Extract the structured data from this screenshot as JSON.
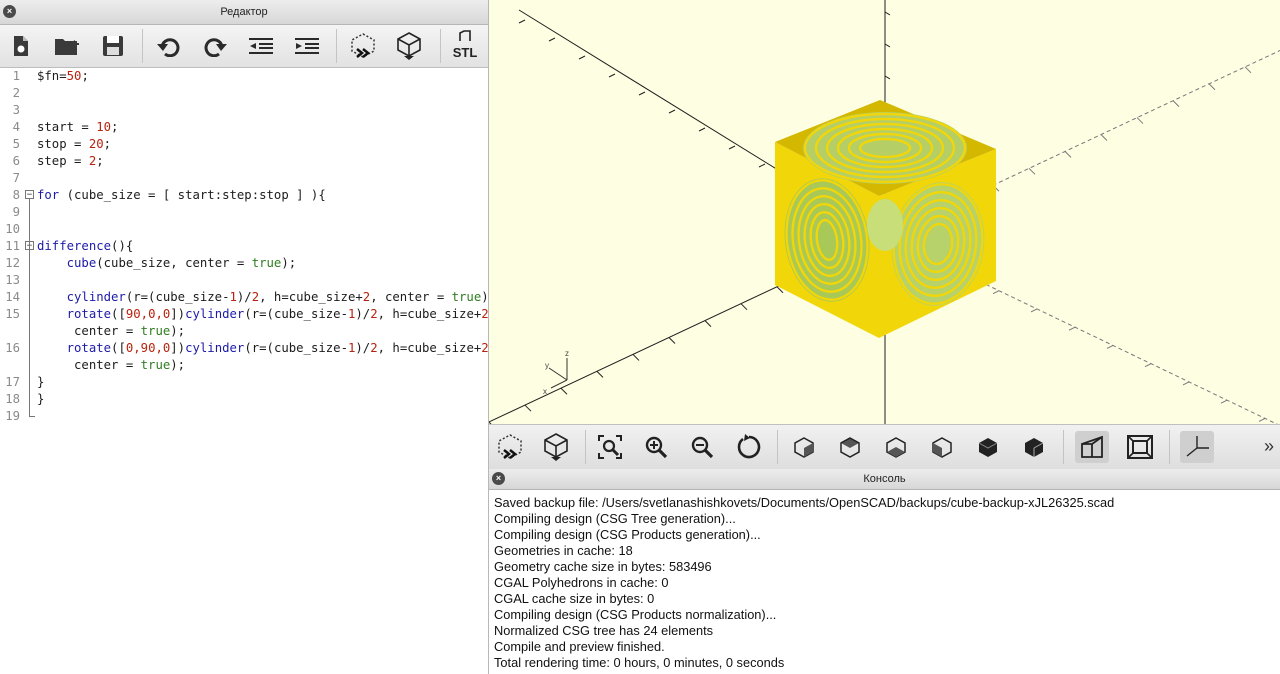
{
  "editor": {
    "title": "Редактор",
    "toolbar": {
      "stl_label": "STL",
      "buttons": [
        "new-file-icon",
        "open-file-icon",
        "save-icon",
        "undo-icon",
        "redo-icon",
        "unindent-icon",
        "indent-icon",
        "preview-icon",
        "render-icon",
        "export-stl-icon"
      ]
    },
    "lines": [
      {
        "n": "1",
        "tokens": [
          [
            "var",
            "$fn"
          ],
          [
            "op",
            "="
          ],
          [
            "num",
            "50"
          ],
          [
            "op",
            ";"
          ]
        ]
      },
      {
        "n": "2",
        "tokens": []
      },
      {
        "n": "3",
        "tokens": []
      },
      {
        "n": "4",
        "tokens": [
          [
            "var",
            "start "
          ],
          [
            "op",
            "= "
          ],
          [
            "num",
            "10"
          ],
          [
            "op",
            ";"
          ]
        ]
      },
      {
        "n": "5",
        "tokens": [
          [
            "var",
            "stop "
          ],
          [
            "op",
            "= "
          ],
          [
            "num",
            "20"
          ],
          [
            "op",
            ";"
          ]
        ]
      },
      {
        "n": "6",
        "tokens": [
          [
            "var",
            "step "
          ],
          [
            "op",
            "= "
          ],
          [
            "num",
            "2"
          ],
          [
            "op",
            ";"
          ]
        ]
      },
      {
        "n": "7",
        "tokens": []
      },
      {
        "n": "8",
        "fold": "start",
        "tokens": [
          [
            "kw",
            "for"
          ],
          [
            "op",
            " (cube_size = [ start:step:stop ] ){"
          ]
        ]
      },
      {
        "n": "9",
        "tokens": []
      },
      {
        "n": "10",
        "tokens": []
      },
      {
        "n": "11",
        "fold": "start",
        "tokens": [
          [
            "kw",
            "difference"
          ],
          [
            "op",
            "(){"
          ]
        ]
      },
      {
        "n": "12",
        "tokens": [
          [
            "fn",
            "    cube"
          ],
          [
            "op",
            "(cube_size, center = "
          ],
          [
            "bool",
            "true"
          ],
          [
            "op",
            ");"
          ]
        ]
      },
      {
        "n": "13",
        "tokens": []
      },
      {
        "n": "14",
        "tokens": [
          [
            "fn",
            "    cylinder"
          ],
          [
            "op",
            "(r=(cube_size-"
          ],
          [
            "num",
            "1"
          ],
          [
            "op",
            ")/"
          ],
          [
            "num",
            "2"
          ],
          [
            "op",
            ", h=cube_size+"
          ],
          [
            "num",
            "2"
          ],
          [
            "op",
            ", center = "
          ],
          [
            "bool",
            "true"
          ],
          [
            "op",
            ");"
          ]
        ]
      },
      {
        "n": "15",
        "tokens": [
          [
            "fn",
            "    rotate"
          ],
          [
            "op",
            "(["
          ],
          [
            "num",
            "90,0,0"
          ],
          [
            "op",
            "])"
          ],
          [
            "fn",
            "cylinder"
          ],
          [
            "op",
            "(r=(cube_size-"
          ],
          [
            "num",
            "1"
          ],
          [
            "op",
            ")/"
          ],
          [
            "num",
            "2"
          ],
          [
            "op",
            ", h=cube_size+"
          ],
          [
            "num",
            "2"
          ],
          [
            "op",
            ", ↩"
          ]
        ],
        "cont": [
          [
            "op",
            "     center = "
          ],
          [
            "bool",
            "true"
          ],
          [
            "op",
            ");"
          ]
        ]
      },
      {
        "n": "16",
        "tokens": [
          [
            "fn",
            "    rotate"
          ],
          [
            "op",
            "(["
          ],
          [
            "num",
            "0,90,0"
          ],
          [
            "op",
            "])"
          ],
          [
            "fn",
            "cylinder"
          ],
          [
            "op",
            "(r=(cube_size-"
          ],
          [
            "num",
            "1"
          ],
          [
            "op",
            ")/"
          ],
          [
            "num",
            "2"
          ],
          [
            "op",
            ", h=cube_size+"
          ],
          [
            "num",
            "2"
          ],
          [
            "op",
            ", ↩"
          ]
        ],
        "cont": [
          [
            "op",
            "     center = "
          ],
          [
            "bool",
            "true"
          ],
          [
            "op",
            ");"
          ]
        ]
      },
      {
        "n": "17",
        "fold": "end",
        "tokens": [
          [
            "op",
            "}"
          ]
        ]
      },
      {
        "n": "18",
        "fold": "end2",
        "tokens": [
          [
            "op",
            "}"
          ]
        ]
      },
      {
        "n": "19",
        "tokens": []
      }
    ]
  },
  "viewport": {
    "background": "#fefee3",
    "cube_color": "#f1d60a",
    "cube_dark": "#d4b800",
    "inner_color": "#c8de78",
    "axis_color": "#1f1f1f",
    "orient_axes": {
      "x": "x",
      "y": "y",
      "z": "z"
    }
  },
  "view_toolbar": {
    "buttons": [
      "preview-icon",
      "render-icon",
      "view-all-icon",
      "zoom-in-icon",
      "zoom-out-icon",
      "reset-view-icon",
      "view-right-icon",
      "view-top-icon",
      "view-bottom-icon",
      "view-left-icon",
      "view-front-icon",
      "view-back-icon",
      "perspective-icon",
      "orthogonal-icon",
      "show-axes-icon"
    ],
    "more": "»"
  },
  "console": {
    "title": "Консоль",
    "lines": [
      "Saved backup file: /Users/svetlanashishkovets/Documents/OpenSCAD/backups/cube-backup-xJL26325.scad",
      "Compiling design (CSG Tree generation)...",
      "Compiling design (CSG Products generation)...",
      "Geometries in cache: 18",
      "Geometry cache size in bytes: 583496",
      "CGAL Polyhedrons in cache: 0",
      "CGAL cache size in bytes: 0",
      "Compiling design (CSG Products normalization)...",
      "Normalized CSG tree has 24 elements",
      "Compile and preview finished.",
      "Total rendering time: 0 hours, 0 minutes, 0 seconds"
    ]
  },
  "colors": {
    "kw": "#1d1ba8",
    "fn": "#1d1ba8",
    "num": "#b8230e",
    "bool": "#2e7d21",
    "var": "#1c1c1c",
    "op": "#1c1c1c"
  }
}
